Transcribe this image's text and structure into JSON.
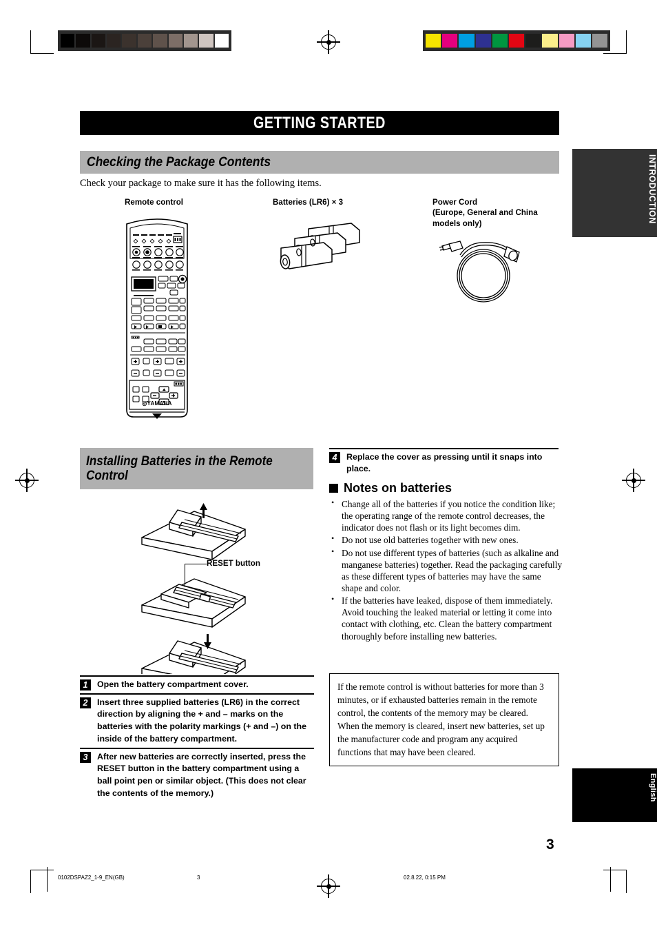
{
  "chapter": {
    "title": "GETTING STARTED"
  },
  "sections": {
    "package": {
      "heading": "Checking the Package Contents",
      "intro": "Check your package to make sure it has the following items.",
      "items": [
        {
          "label": "Remote control",
          "icon": "remote-control-illustration"
        },
        {
          "label": "Batteries (LR6) × 3",
          "icon": "batteries-illustration"
        },
        {
          "label": "Power Cord\n(Europe, General and China\nmodels only)",
          "icon": "power-cord-illustration"
        }
      ]
    },
    "installing": {
      "heading": "Installing Batteries in the Remote Control",
      "reset_callout": "RESET button",
      "steps": [
        {
          "num": "1",
          "text": "Open the battery compartment cover."
        },
        {
          "num": "2",
          "text": "Insert three supplied batteries (LR6) in the correct direction by aligning the + and – marks on the batteries with the polarity markings (+ and –) on the inside of the battery compartment."
        },
        {
          "num": "3",
          "text": "After new batteries are correctly inserted, press the RESET button in the battery compartment using a ball point pen or similar object. (This does not clear the contents of the memory.)"
        },
        {
          "num": "4",
          "text": "Replace the cover as pressing until it snaps into place."
        }
      ]
    },
    "notes": {
      "heading": "Notes on batteries",
      "bullets": [
        "Change all of the batteries if you notice the condition like; the operating range of the remote control decreases, the indicator does not flash or its light becomes dim.",
        "Do not use old batteries together with new ones.",
        "Do not use different types of batteries (such as alkaline and manganese batteries) together. Read the packaging carefully as these different types of batteries may have the same shape and color.",
        "If the batteries have leaked, dispose of them immediately. Avoid touching the leaked material or letting it come into contact with clothing, etc. Clean the battery compartment thoroughly before installing new batteries."
      ],
      "memo": "If the remote control is without batteries for more than 3 minutes, or if exhausted batteries remain in the remote control, the contents of the memory may be cleared. When the memory is cleared, insert new batteries, set up the manufacturer code and program any acquired functions that may have been cleared."
    }
  },
  "side_tabs": {
    "introduction": "INTRODUCTION",
    "language": "English"
  },
  "page_number": "3",
  "footer": {
    "file": "0102DSPAZ2_1-9_EN(GB)",
    "page": "3",
    "timestamp": "02.8.22, 0:15 PM"
  },
  "brand": "YAMAHA",
  "calibration": {
    "gray_wedge": [
      "#000000",
      "#0d0a09",
      "#1b1614",
      "#2b2421",
      "#3b322d",
      "#4b403a",
      "#5f524b",
      "#7d6e67",
      "#a2958e",
      "#cfc5c0",
      "#ffffff"
    ],
    "color_bars": [
      "#f6e400",
      "#e5007e",
      "#009fe3",
      "#2e3192",
      "#009640",
      "#e30613",
      "#1d1d1b",
      "#fbee8b",
      "#f59bc3",
      "#86d3f2",
      "#949494"
    ]
  }
}
